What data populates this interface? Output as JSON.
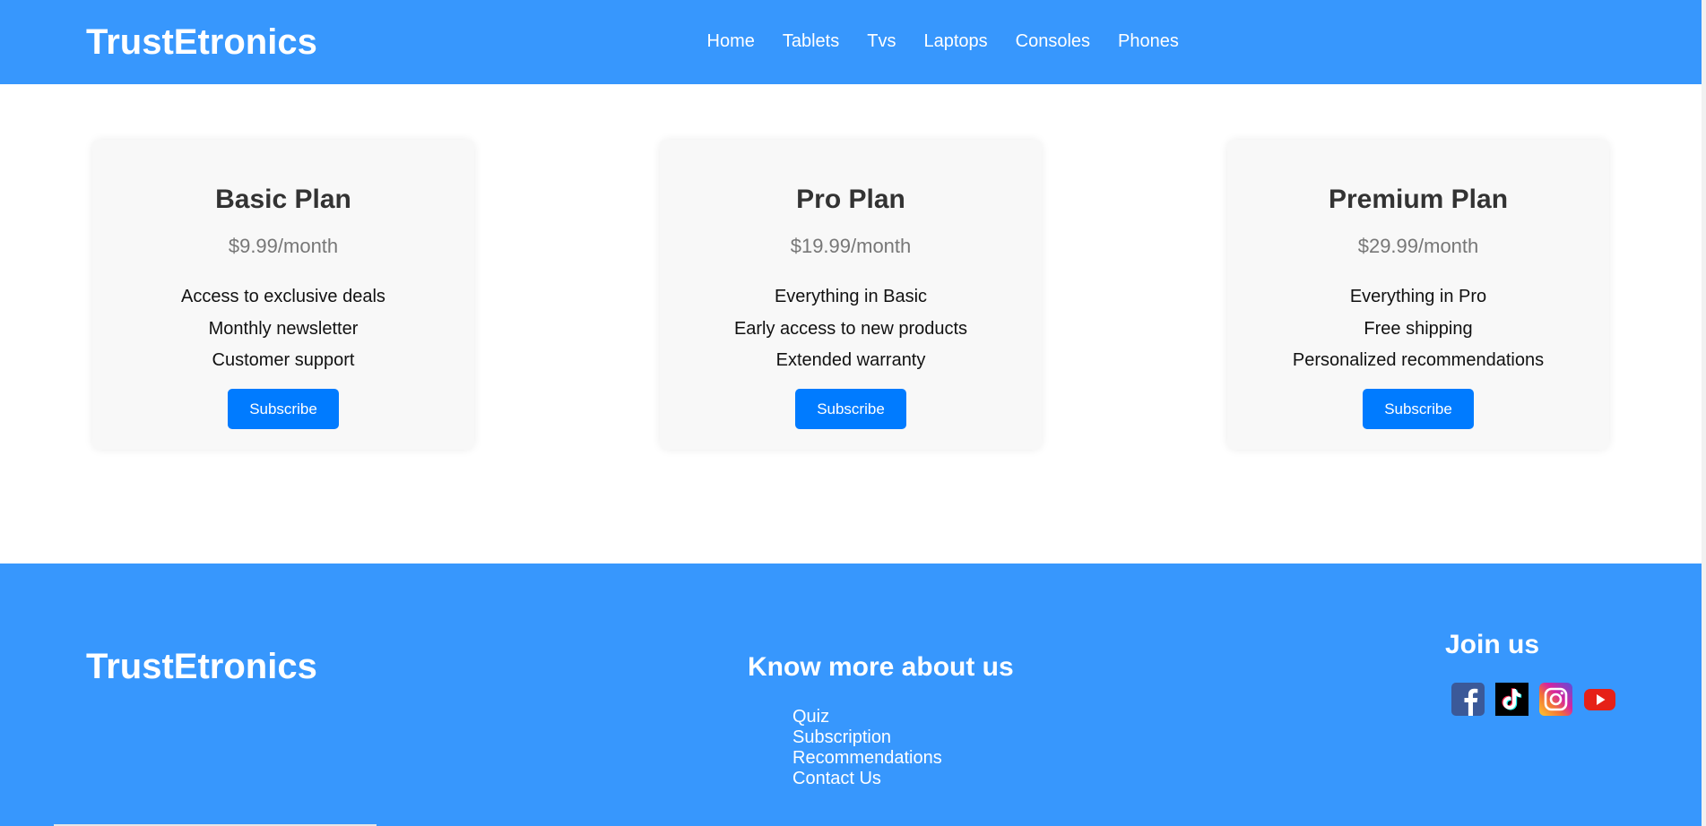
{
  "header": {
    "brand": "TrustEtronics",
    "nav": [
      "Home",
      "Tablets",
      "Tvs",
      "Laptops",
      "Consoles",
      "Phones"
    ]
  },
  "plans": [
    {
      "title": "Basic Plan",
      "price": "$9.99/month",
      "features": [
        "Access to exclusive deals",
        "Monthly newsletter",
        "Customer support"
      ],
      "button": "Subscribe"
    },
    {
      "title": "Pro Plan",
      "price": "$19.99/month",
      "features": [
        "Everything in Basic",
        "Early access to new products",
        "Extended warranty"
      ],
      "button": "Subscribe"
    },
    {
      "title": "Premium Plan",
      "price": "$29.99/month",
      "features": [
        "Everything in Pro",
        "Free shipping",
        "Personalized recommendations"
      ],
      "button": "Subscribe"
    }
  ],
  "footer": {
    "brand": "TrustEtronics",
    "about_title": "Know more about us",
    "links": [
      "Quiz",
      "Subscription",
      "Recommendations",
      "Contact Us"
    ],
    "join_title": "Join us",
    "social": [
      "facebook-icon",
      "tiktok-icon",
      "instagram-icon",
      "youtube-icon"
    ]
  },
  "colors": {
    "brand_blue": "#3797fd",
    "button_blue": "#007bff",
    "card_bg": "#f8f8f8"
  }
}
